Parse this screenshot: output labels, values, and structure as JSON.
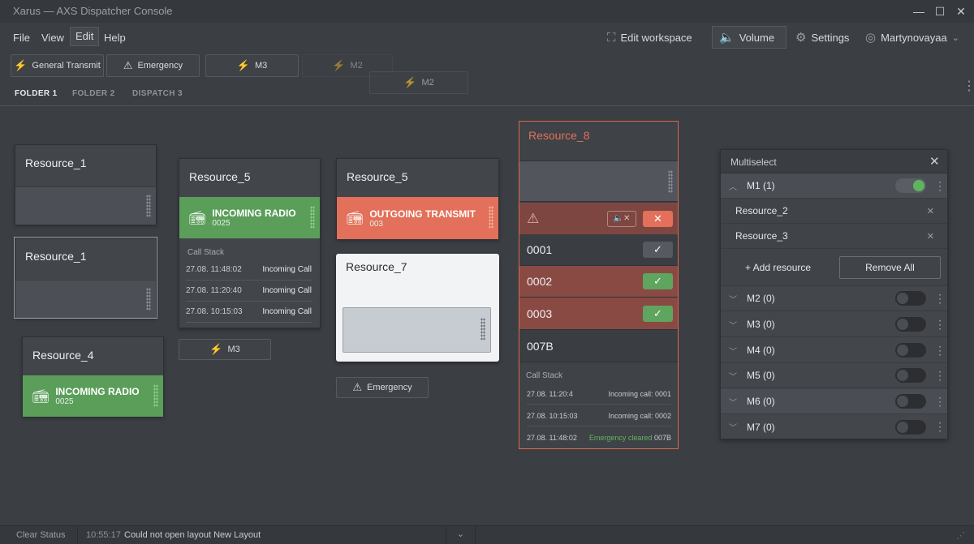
{
  "window": {
    "title": "Xarus — AXS Dispatcher Console",
    "minimize": "—",
    "maximize": "☐",
    "close": "✕"
  },
  "menu": {
    "file": "File",
    "view": "View",
    "edit": "Edit",
    "help": "Help"
  },
  "toolbar": {
    "edit_workspace": "Edit workspace",
    "volume": "Volume",
    "settings": "Settings",
    "user": "Martynovayaa"
  },
  "quick_buttons": {
    "general_transmit": "General Transmit",
    "emergency": "Emergency",
    "m3": "M3",
    "m2": "M2",
    "m2_drag": "M2"
  },
  "tabs": {
    "folder1": "FOLDER 1",
    "folder2": "FOLDER 2",
    "dispatch3": "DISPATCH 3"
  },
  "cards": {
    "r1a": {
      "name": "Resource_1"
    },
    "r1b": {
      "name": "Resource_1"
    },
    "r4": {
      "name": "Resource_4",
      "status": "INCOMING RADIO",
      "code": "0025"
    },
    "r5a": {
      "name": "Resource_5",
      "status": "INCOMING RADIO",
      "code": "0025",
      "stack_title": "Call Stack",
      "stack": [
        {
          "time": "27.08. 11:48:02",
          "text": "Incoming Call"
        },
        {
          "time": "27.08. 11:20:40",
          "text": "Incoming Call"
        },
        {
          "time": "27.08. 10:15:03",
          "text": "Incoming Call"
        }
      ]
    },
    "r5b": {
      "name": "Resource_5",
      "status": "OUTGOING TRANSMIT",
      "code": "003"
    },
    "r7": {
      "name": "Resource_7"
    },
    "m3": {
      "label": "M3"
    },
    "emergency": {
      "label": "Emergency"
    }
  },
  "r8": {
    "name": "Resource_8",
    "rows": [
      {
        "id": "0001",
        "state": "ack"
      },
      {
        "id": "0002",
        "state": "new"
      },
      {
        "id": "0003",
        "state": "new"
      },
      {
        "id": "007B",
        "state": "none"
      }
    ],
    "stack_title": "Call Stack",
    "stack": [
      {
        "time": "27.08. 11:20:4",
        "text": "Incoming call: 0001"
      },
      {
        "time": "27.08. 10:15:03",
        "text": "Incoming call: 0002"
      },
      {
        "time": "27.08. 11:48:02",
        "text": "Emergency cleared",
        "extra": "007B"
      }
    ]
  },
  "multiselect": {
    "title": "Multiselect",
    "add_resource": "+ Add resource",
    "remove_all": "Remove All",
    "m1": {
      "label": "M1 (1)",
      "on": true
    },
    "members": [
      "Resource_2",
      "Resource_3"
    ],
    "groups": [
      {
        "label": "M2 (0)"
      },
      {
        "label": "M3 (0)"
      },
      {
        "label": "M4 (0)"
      },
      {
        "label": "M5 (0)"
      },
      {
        "label": "M6 (0)"
      },
      {
        "label": "M7 (0)"
      }
    ]
  },
  "footer": {
    "clear_status": "Clear Status",
    "time": "10:55:17",
    "message": "Could not open layout New Layout"
  },
  "colors": {
    "accent_orange": "#e2705a",
    "accent_green": "#5a9e5a",
    "background": "#3b3e43"
  }
}
